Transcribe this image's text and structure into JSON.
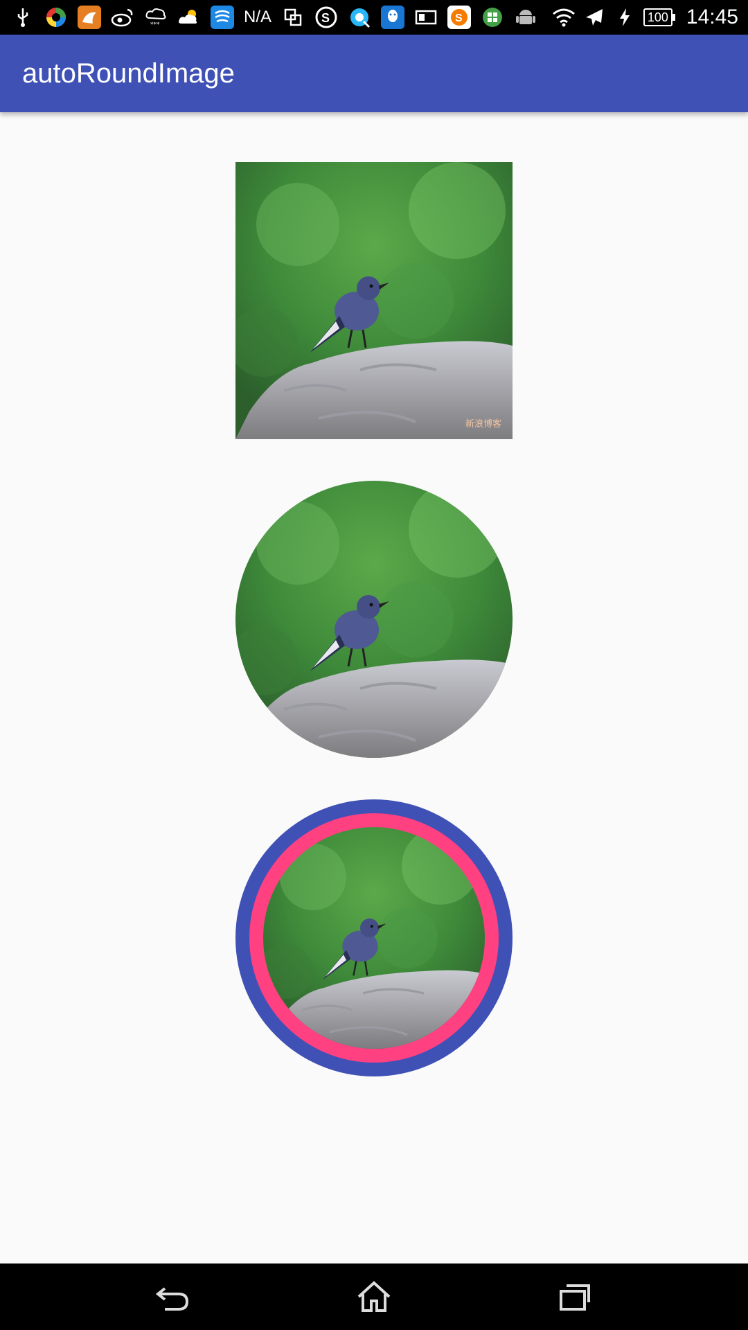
{
  "status_bar": {
    "network_text": "N/A",
    "battery_level": "100",
    "time": "14:45",
    "left_icons": [
      "usb-icon",
      "color-wheel-icon",
      "app-icon",
      "weibo-icon",
      "snow-cloud-icon",
      "partly-cloudy-icon",
      "chat-app-icon"
    ],
    "right_icons": [
      "wifi-icon",
      "airplane-icon",
      "charging-icon",
      "battery-icon"
    ]
  },
  "app_bar": {
    "title": "autoRoundImage"
  },
  "images": {
    "square": {
      "shape": "square"
    },
    "round": {
      "shape": "circle"
    },
    "bordered": {
      "shape": "circle",
      "outer_border_color": "#3f51b5",
      "inner_border_color": "#ff4081"
    },
    "watermark": "新浪博客"
  },
  "nav_bar": {
    "buttons": [
      "back-icon",
      "home-icon",
      "recent-apps-icon"
    ]
  },
  "colors": {
    "primary": "#3f51b5",
    "accent": "#ff4081",
    "background": "#fafafa"
  }
}
